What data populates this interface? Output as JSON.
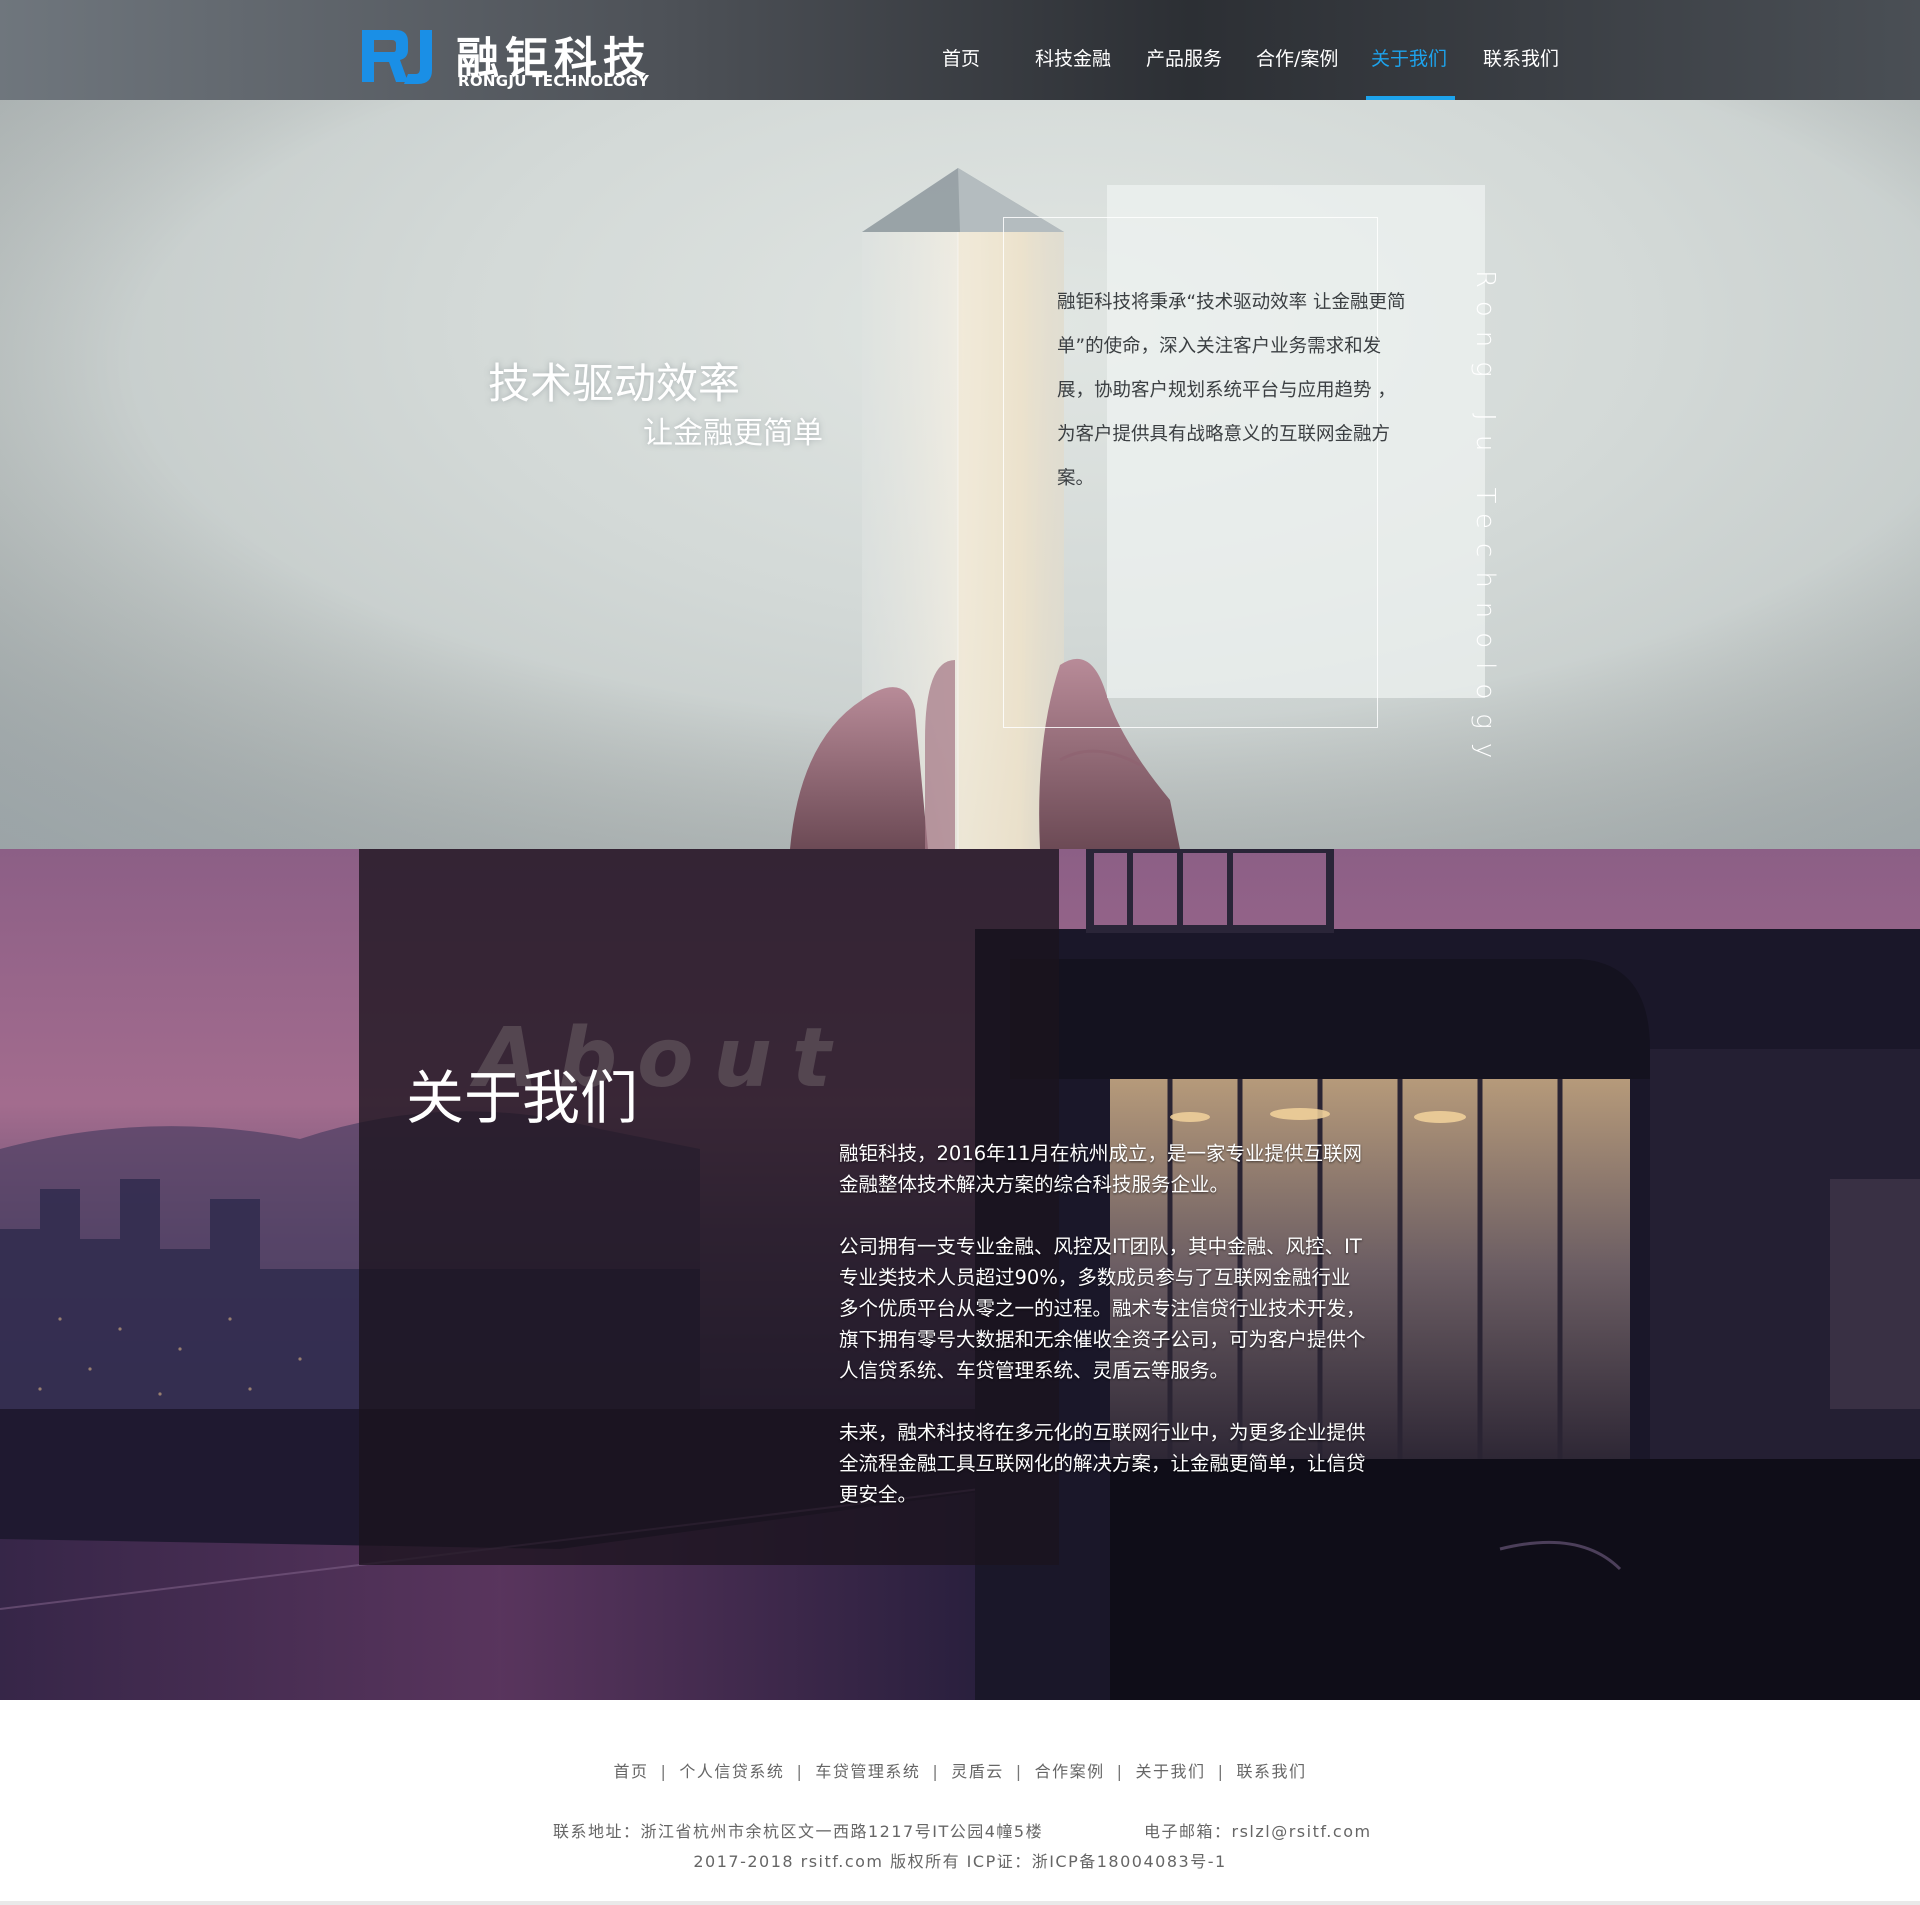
{
  "brand": {
    "name_cn": "融钜科技",
    "name_en": "RONGJU TECHNOLOGY",
    "mark_color": "#1a8fe6"
  },
  "nav": {
    "items": [
      {
        "label": "首页"
      },
      {
        "label": "科技金融"
      },
      {
        "label": "产品服务"
      },
      {
        "label": "合作/案例"
      },
      {
        "label": "关于我们",
        "active": true
      },
      {
        "label": "联系我们"
      }
    ],
    "active_color": "#1da3ec"
  },
  "hero": {
    "slogan_line1": "技术驱动效率",
    "slogan_line2": "让金融更简单",
    "description": "融钜科技将秉承“技术驱动效率 让金融更简单”的使命，深入关注客户业务需求和发展，协助客户规划系统平台与应用趋势 ，为客户提供具有战略意义的互联网金融方案。",
    "vertical_text": "Rong Ju Technology"
  },
  "about": {
    "title_en": "About",
    "title_cn": "关于我们",
    "paragraphs": [
      "融钜科技，2016年11月在杭州成立，是一家专业提供互联网金融整体技术解决方案的综合科技服务企业。",
      "公司拥有一支专业金融、风控及IT团队，其中金融、风控、IT专业类技术人员超过90%，多数成员参与了互联网金融行业多个优质平台从零之一的过程。融术专注信贷行业技术开发，旗下拥有零号大数据和无余催收全资子公司，可为客户提供个人信贷系统、车贷管理系统、灵盾云等服务。",
      "未来，融术科技将在多元化的互联网行业中，为更多企业提供全流程金融工具互联网化的解决方案，让金融更简单，让信贷更安全。"
    ]
  },
  "footer": {
    "links": [
      "首页",
      "个人信贷系统",
      "车贷管理系统",
      "灵盾云",
      "合作案例",
      "关于我们",
      "联系我们"
    ],
    "separator": "|",
    "address": "联系地址：浙江省杭州市余杭区文一西路1217号IT公园4幢5楼",
    "email": "电子邮箱：rslzl@rsitf.com",
    "copyright": "2017-2018 rsitf.com 版权所有 ICP证：浙ICP备18004083号-1"
  }
}
